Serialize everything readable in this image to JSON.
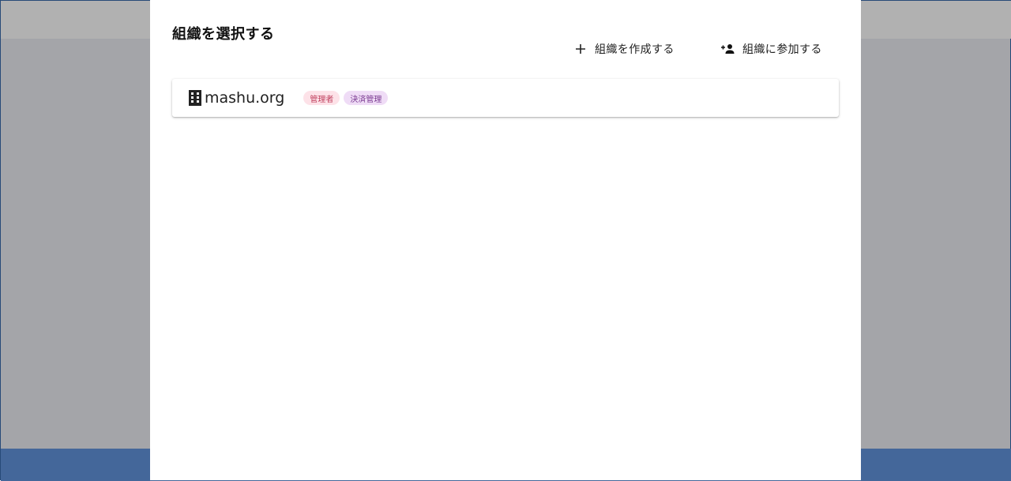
{
  "dialog": {
    "title": "組織を選択する",
    "actions": {
      "create_label": "組織を作成する",
      "join_label": "組織に参加する"
    }
  },
  "organizations": [
    {
      "name": "mashu.org",
      "icon": "building-icon",
      "roles": [
        "管理者",
        "決済管理"
      ]
    }
  ],
  "colors": {
    "overlay": "#a4a5a9",
    "footer": "#44679a",
    "chip_admin_bg": "#fde2e8",
    "chip_admin_text": "#c0405e",
    "chip_billing_bg": "#efdcf6",
    "chip_billing_text": "#7a3a91"
  }
}
